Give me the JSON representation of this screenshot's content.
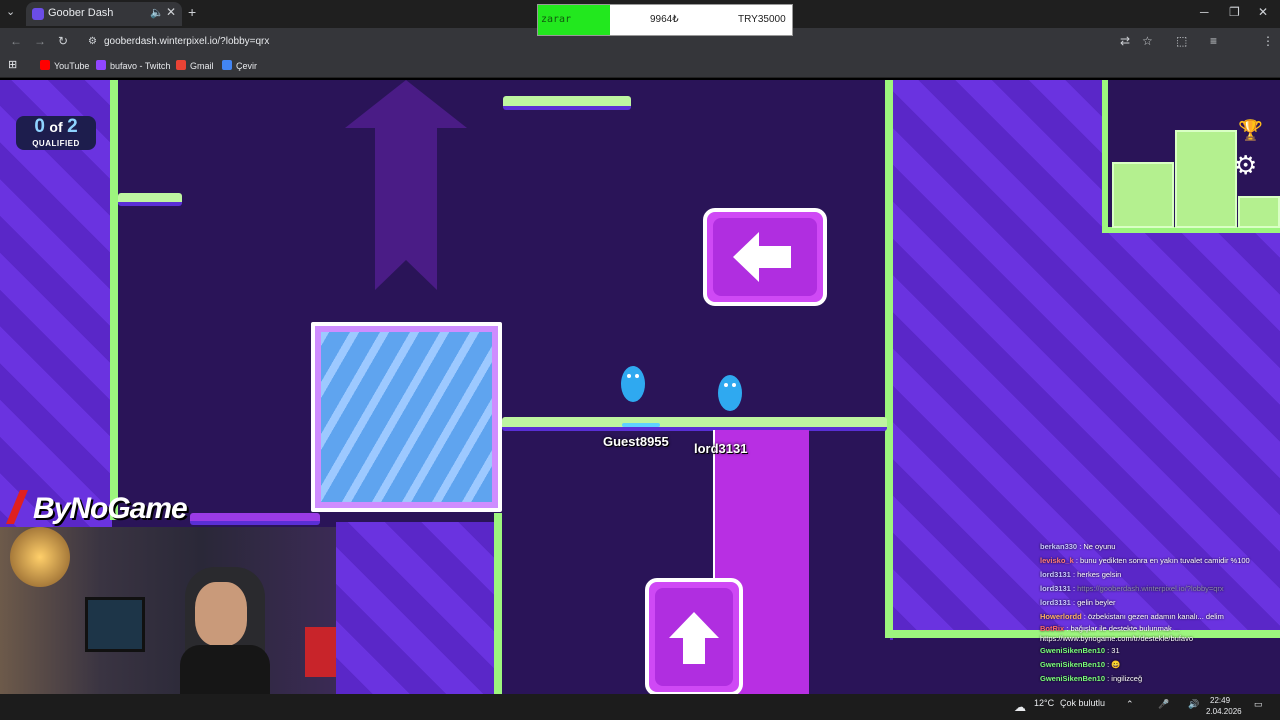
{
  "browser": {
    "tab_title": "Goober Dash",
    "url": "gooberdash.winterpixel.io/?lobby=qrx",
    "bookmarks": [
      {
        "label": "YouTube",
        "color": "#ff0000"
      },
      {
        "label": "bufavo - Twitch",
        "color": "#9146ff"
      },
      {
        "label": "Gmail",
        "color": "#ea4335"
      },
      {
        "label": "Çevir",
        "color": "#4285f4"
      }
    ]
  },
  "overlay": {
    "left_label": "zarar",
    "middle_value": "9964₺",
    "right_value": "TRY35000"
  },
  "game": {
    "qualified_count": "0",
    "qualified_of": "of",
    "qualified_total": "2",
    "qualified_label": "QUALIFIED",
    "players": [
      {
        "name": "Guest8955"
      },
      {
        "name": "lord3131"
      }
    ]
  },
  "stream": {
    "logo_text": "ByNoGame"
  },
  "chat": [
    {
      "user": "berkan330",
      "message": "Ne oyunu"
    },
    {
      "user": "levisko_k",
      "message": "bunu yedikten sonra en yakın tuvalet camidir %100"
    },
    {
      "user": "lord3131",
      "message": "herkes gelsin"
    },
    {
      "user": "lord3131",
      "message": "https://gooberdash.winterpixel.io/?lobby=qrx"
    },
    {
      "user": "lord3131",
      "message": "gelin beyler"
    },
    {
      "user": "Howerlordd",
      "message": "özbekistanı gezen adamın kanalı... delim"
    },
    {
      "user": "BotRix",
      "message": "bağışlar ile destekte bulunmak ... https://www.bynogame.com/tr/destekle/bufavo"
    },
    {
      "user": "GweniSikenBen10",
      "message": "31"
    },
    {
      "user": "GweniSikenBen10",
      "message": "😀"
    },
    {
      "user": "GweniSikenBen10",
      "message": "ingilizceğ"
    },
    {
      "user": "GweniSikenBen10",
      "message": "😀"
    },
    {
      "user": "levisko_k",
      "message": "şimdiden sıktı aq"
    }
  ],
  "taskbar": {
    "weather_temp": "12°C",
    "weather_text": "Çok bulutlu",
    "time": "22:49",
    "date": "2.04.2026"
  }
}
